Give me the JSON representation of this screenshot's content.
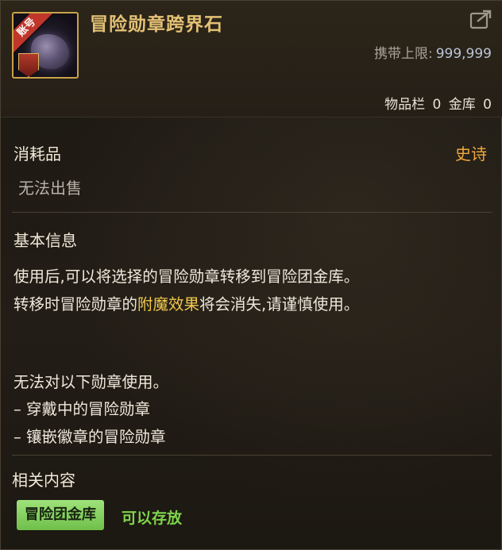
{
  "item": {
    "badge": "账号",
    "name": "冒险勋章跨界石",
    "stack_limit_label": "携带上限:",
    "stack_limit_value": "999,999",
    "inventory_label": "物品栏",
    "inventory_count": "0",
    "vault_label": "金库",
    "vault_count": "0",
    "type": "消耗品",
    "rarity": "史诗",
    "sell_status": "无法出售"
  },
  "basic_info": {
    "title": "基本信息",
    "line1": "使用后,可以将选择的冒险勋章转移到冒险团金库。",
    "line2_prefix": "转移时冒险勋章的",
    "line2_highlight": "附魔效果",
    "line2_suffix": "将会消失,请谨慎使用。",
    "restriction_title": "无法对以下勋章使用。",
    "restriction_1": "– 穿戴中的冒险勋章",
    "restriction_2": "– 镶嵌徽章的冒险勋章"
  },
  "related": {
    "title": "相关内容",
    "tag": "冒险团金库",
    "note": "可以存放"
  },
  "colors": {
    "name": "#e3c074",
    "rarity": "#f2a93b",
    "highlight": "#f2c94c",
    "tag_bg": "#8fd66a",
    "note": "#7fd44b"
  },
  "icons": [
    "item-icon",
    "share-icon"
  ]
}
